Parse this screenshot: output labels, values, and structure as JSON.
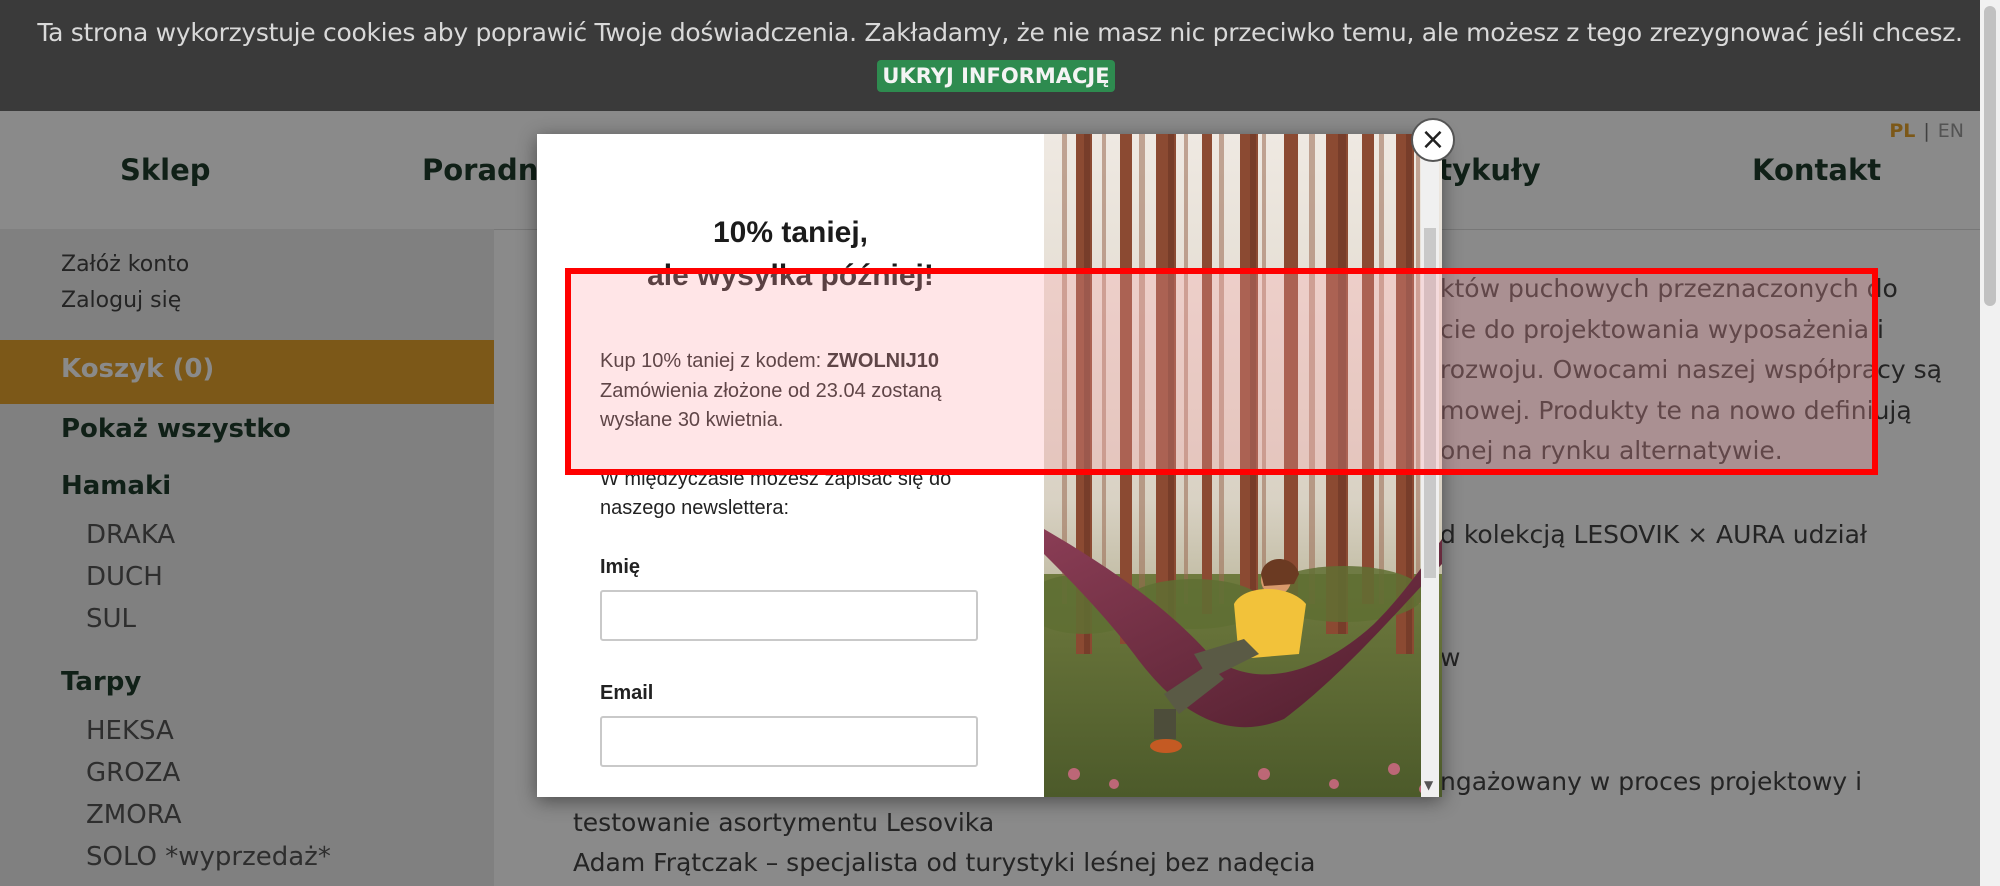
{
  "cookie_bar": {
    "text": "Ta strona wykorzystuje cookies aby poprawić Twoje doświadczenia. Zakładamy, że nie masz nic przeciwko temu, ale możesz z tego zrezygnować jeśli chcesz.",
    "button": "UKRYJ INFORMACJĘ"
  },
  "lang": {
    "pl": "PL",
    "sep": "|",
    "en": "EN"
  },
  "nav": {
    "items": [
      "Sklep",
      "Poradn",
      "rtykuły",
      "Kontakt"
    ]
  },
  "sidebar": {
    "create_account": "Załóż konto",
    "login": "Zaloguj się",
    "cart": "Koszyk (0)",
    "show_all": "Pokaż wszystko",
    "hammocks": "Hamaki",
    "hammock_items": [
      "DRAKA",
      "DUCH",
      "SUL"
    ],
    "tarps": "Tarpy",
    "tarp_items": [
      "HEKSA",
      "GROZA",
      "ZMORA",
      "SOLO *wyprzedaż*"
    ]
  },
  "main": {
    "lines": [
      "któw puchowych przeznaczonych do",
      "cie do projektowania wyposażenia i",
      "rozwoju. Owocami naszej współpracy są",
      "mowej. Produkty te na nowo definiują",
      "onej na rynku alternatywie.",
      "d kolekcją LESOVIK × AURA udział",
      "w",
      "ngażowany w proces projektowy i",
      "testowanie asortymentu Lesovika",
      "Adam Frątczak – specjalista od turystyki leśnej bez nadęcia"
    ]
  },
  "modal": {
    "title_line1": "10% taniej,",
    "title_line2": "ale wysyłka później!",
    "promo_prefix": "Kup 10% taniej z kodem: ",
    "promo_code": "ZWOLNIJ10",
    "promo_line2": "Zamówienia złożone od 23.04 zostaną",
    "promo_line3": "wysłane 30 kwietnia.",
    "newsletter_line1": "W międzyczasie możesz zapisać się do",
    "newsletter_line2": "naszego newslettera:",
    "name_label": "Imię",
    "email_label": "Email",
    "close": "×"
  },
  "colors": {
    "accent": "#e5a32d",
    "cookie_button": "#2e8b4f",
    "nav_text": "#1f3b2c",
    "highlight": "#ff0000"
  }
}
